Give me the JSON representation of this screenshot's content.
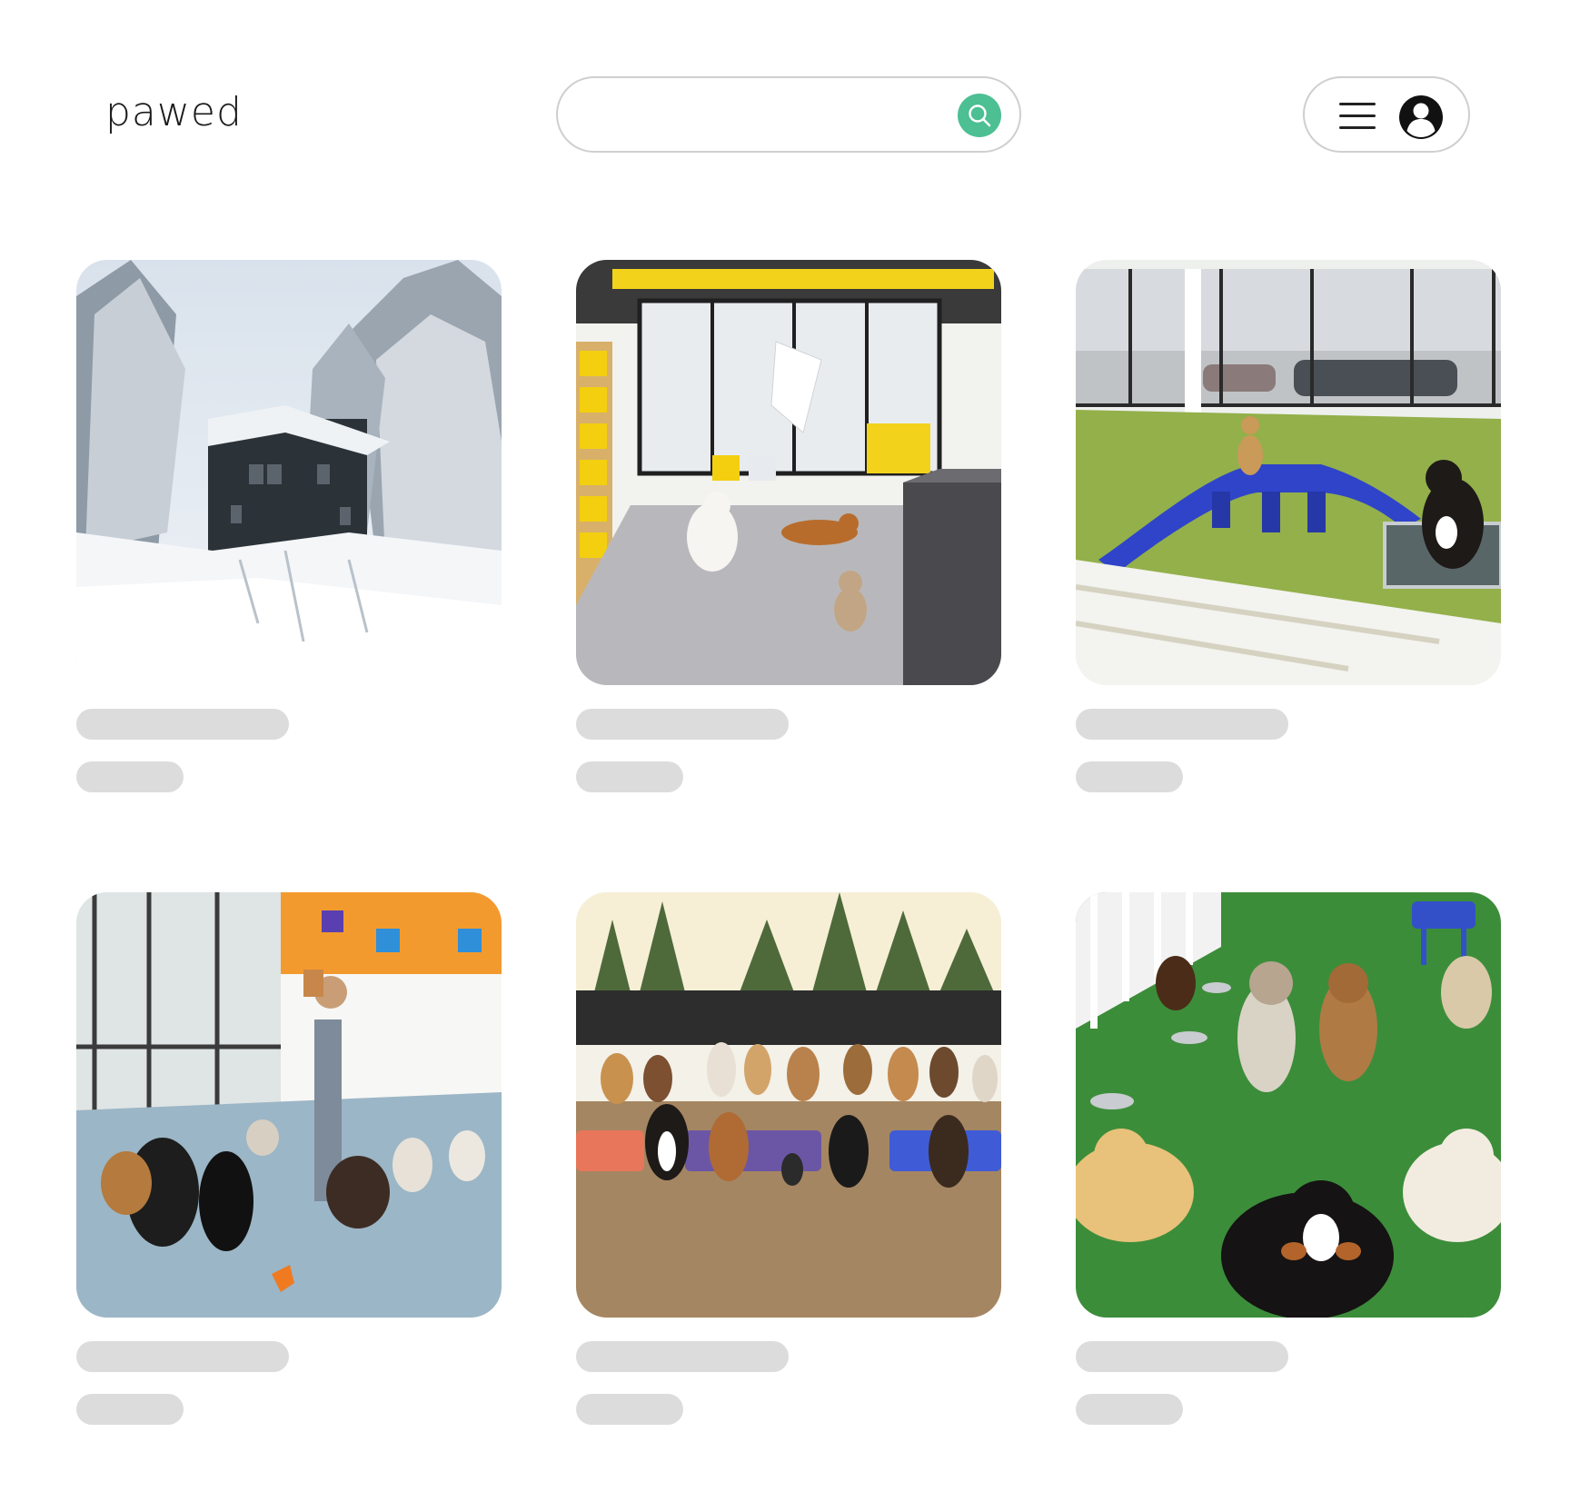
{
  "header": {
    "logo": "pawed",
    "search": {
      "value": "",
      "placeholder": ""
    },
    "search_icon": "search-icon",
    "menu_icon": "hamburger-menu-icon",
    "profile_icon": "user-avatar-icon",
    "accent": "#4cbf93"
  },
  "listings": [
    {
      "image": "snowy-forest-cabin",
      "title": "",
      "subtitle": ""
    },
    {
      "image": "indoor-dog-daycare-yellow",
      "title": "",
      "subtitle": ""
    },
    {
      "image": "dog-playroom-blue-bridge",
      "title": "",
      "subtitle": ""
    },
    {
      "image": "trainer-with-dogs",
      "title": "",
      "subtitle": ""
    },
    {
      "image": "dog-pack-outdoor-yard",
      "title": "",
      "subtitle": ""
    },
    {
      "image": "dogs-on-artificial-turf",
      "title": "",
      "subtitle": ""
    }
  ],
  "colors": {
    "skeleton": "#dcdcdc",
    "border": "#cfcfcf"
  }
}
